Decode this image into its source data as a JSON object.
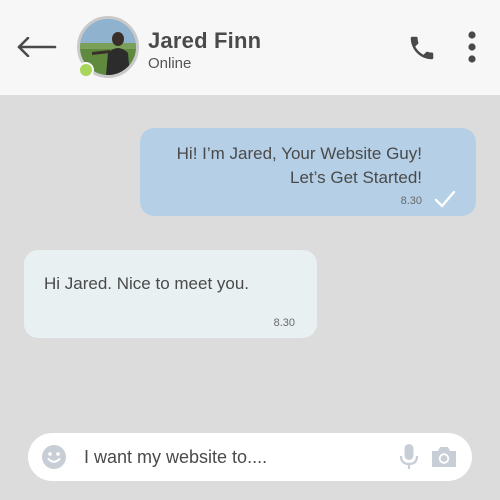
{
  "header": {
    "contact_name": "Jared Finn",
    "contact_status": "Online",
    "status_color": "#a8d65a",
    "icons": {
      "back": "back-arrow-icon",
      "call": "phone-icon",
      "more": "more-vertical-icon"
    }
  },
  "messages": [
    {
      "direction": "outgoing",
      "lines": [
        "Hi! I’m Jared, Your Website Guy!",
        "Let’s Get Started!"
      ],
      "time": "8.30",
      "read": true
    },
    {
      "direction": "incoming",
      "lines": [
        "Hi Jared. Nice to meet you."
      ],
      "time": "8.30"
    }
  ],
  "composer": {
    "value": "I want my website to....",
    "icons": {
      "emoji": "emoji-icon",
      "mic": "microphone-icon",
      "camera": "camera-icon"
    }
  },
  "colors": {
    "background": "#dcdcdc",
    "header": "#f7f7f7",
    "outgoing_bubble": "#b4cfe6",
    "incoming_bubble": "#e8f0f2",
    "icon_dark": "#4a4a4a",
    "icon_light": "#c8ced6"
  }
}
